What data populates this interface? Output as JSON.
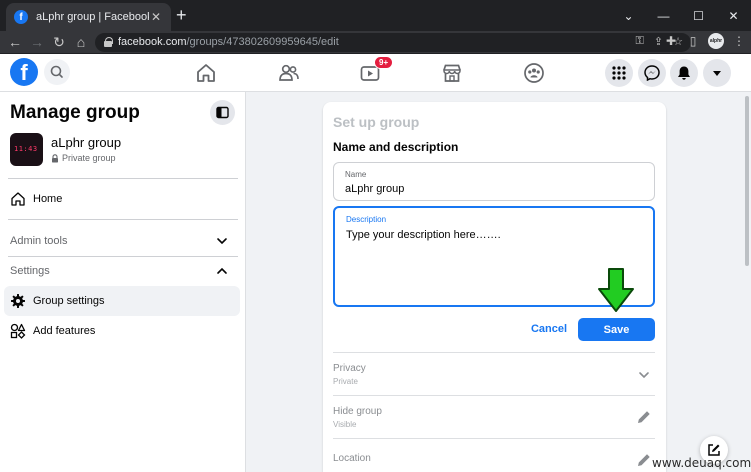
{
  "browser": {
    "tab_title": "aLphr group | Facebook",
    "tab_favicon": "f",
    "url_host": "facebook.com",
    "url_path": "/groups/473802609959645/edit",
    "profile_initials": "alphr"
  },
  "header": {
    "logo": "f",
    "notification_badge": "9+"
  },
  "sidebar": {
    "title": "Manage group",
    "group_name": "aLphr group",
    "group_privacy": "Private group",
    "group_thumb_text": "11:43",
    "home_label": "Home",
    "admin_tools_label": "Admin tools",
    "settings_label": "Settings",
    "items": [
      {
        "label": "Group settings",
        "icon": "gear-icon",
        "active": true
      },
      {
        "label": "Add features",
        "icon": "shapes-icon",
        "active": false
      }
    ]
  },
  "main": {
    "panel_title": "Set up group",
    "section_title": "Name and description",
    "name_field": {
      "label": "Name",
      "value": "aLphr group"
    },
    "description_field": {
      "label": "Description",
      "placeholder": "Type your description here……."
    },
    "cancel_label": "Cancel",
    "save_label": "Save",
    "settings_rows": [
      {
        "title": "Privacy",
        "value": "Private",
        "icon": "chevron-down-icon"
      },
      {
        "title": "Hide group",
        "value": "Visible",
        "icon": "pencil-icon"
      },
      {
        "title": "Location",
        "value": "",
        "icon": "pencil-icon"
      }
    ]
  },
  "watermark": "www.deuaq.com",
  "colors": {
    "accent": "#1877f2",
    "arrow": "#22cc22",
    "badge": "#e41e3f"
  }
}
